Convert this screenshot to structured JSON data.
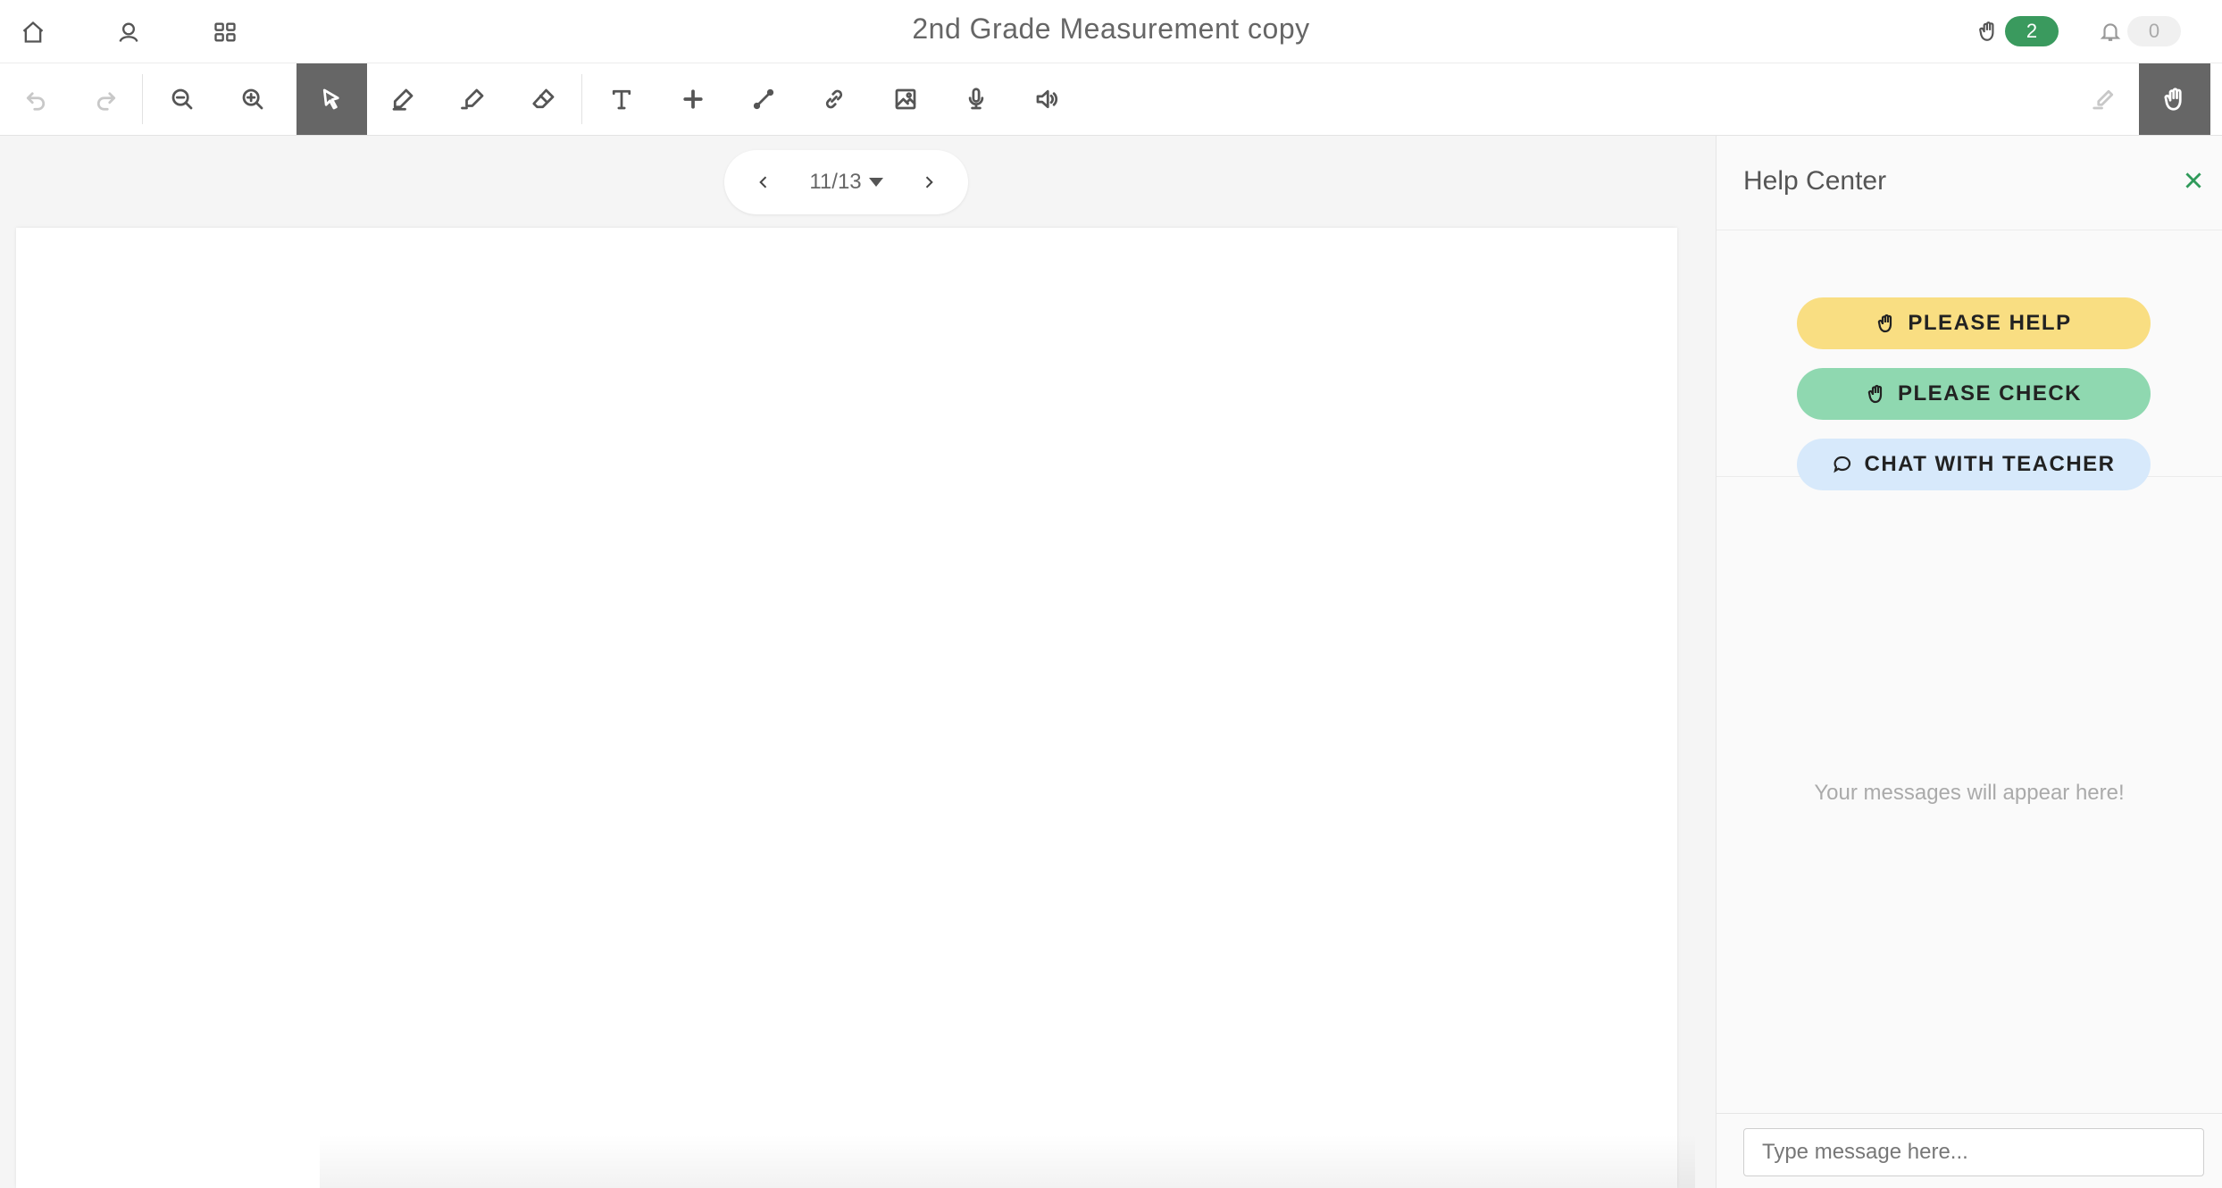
{
  "header": {
    "title": "2nd Grade Measurement copy",
    "hand_count": "2",
    "notification_count": "0",
    "icons": [
      "home-icon",
      "user-icon",
      "grid-icon",
      "raised-hand-icon",
      "bell-icon"
    ]
  },
  "toolbar": {
    "tools": [
      "undo",
      "redo",
      "zoom-out",
      "zoom-in",
      "select",
      "pen",
      "highlighter",
      "eraser",
      "text",
      "add",
      "line",
      "link",
      "image",
      "microphone",
      "speaker",
      "signature",
      "raise-hand"
    ],
    "active_tool": "select"
  },
  "pager": {
    "current": "11/13"
  },
  "help_center": {
    "title": "Help Center",
    "buttons": {
      "please_help": "PLEASE HELP",
      "please_check": "PLEASE CHECK",
      "chat_with_teacher": "CHAT WITH TEACHER"
    },
    "empty_message": "Your messages will appear here!",
    "input_placeholder": "Type message here..."
  },
  "colors": {
    "accent_green": "#3a9a5e",
    "please_help_bg": "#f9de82",
    "please_check_bg": "#8fd8b0",
    "chat_bg": "#d7e9fb",
    "active_tool_bg": "#666666"
  }
}
